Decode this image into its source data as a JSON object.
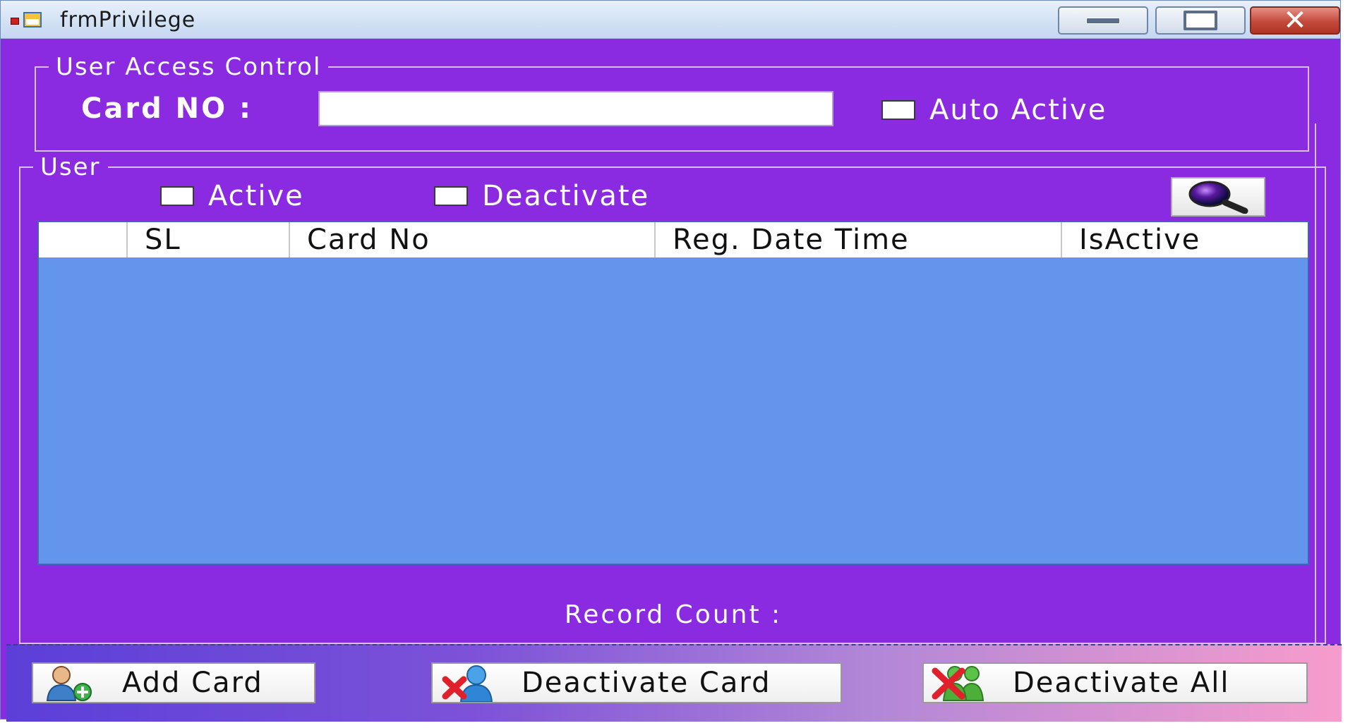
{
  "window": {
    "title": "frmPrivilege",
    "controls": {
      "minimize": "minimize",
      "maximize": "maximize",
      "close": "close"
    }
  },
  "access_control": {
    "legend": "User Access Control",
    "card_label": "Card NO :",
    "card_value": "",
    "auto_active_label": "Auto Active",
    "auto_active_checked": false
  },
  "user": {
    "legend": "User",
    "active_label": "Active",
    "active_checked": false,
    "deactivate_label": "Deactivate",
    "deactivate_checked": false,
    "search_icon": "magnifier-icon"
  },
  "grid": {
    "columns": [
      "",
      "SL",
      "Card No",
      "Reg. Date Time",
      "IsActive"
    ],
    "rows": [],
    "background": "#6495ed"
  },
  "record_count": {
    "label": "Record Count :",
    "value": ""
  },
  "toolbar": {
    "add_card": "Add Card",
    "deactivate_card": "Deactivate Card",
    "deactivate_all": "Deactivate All"
  },
  "colors": {
    "form_background": "#8a2be2",
    "grid_background": "#6495ed"
  }
}
